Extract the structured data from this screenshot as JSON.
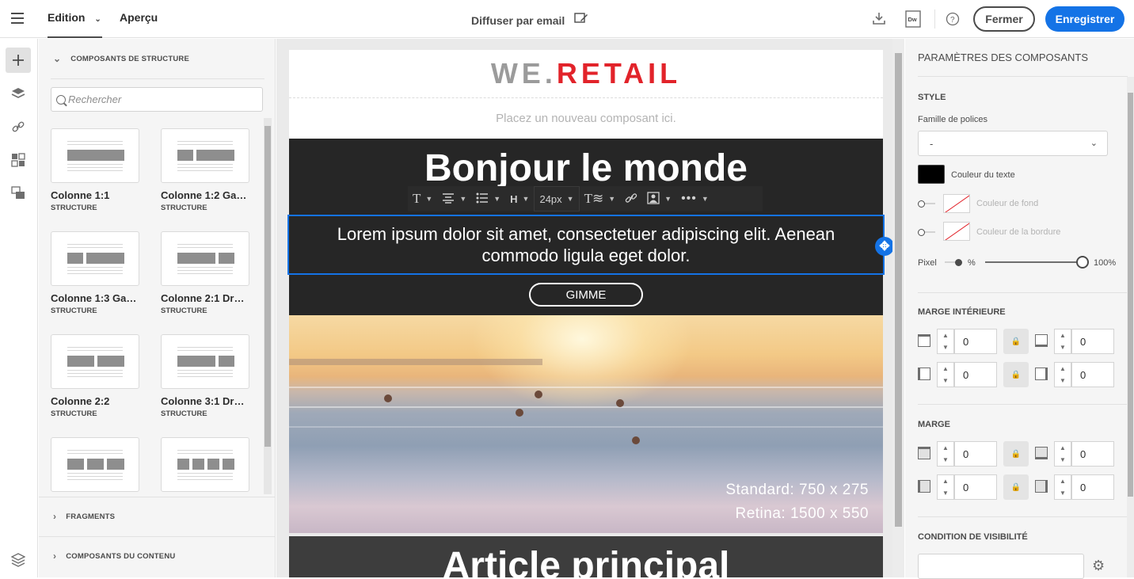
{
  "topbar": {
    "tabs": [
      "Edition",
      "Aperçu"
    ],
    "email_label": "Diffuser par email",
    "close_label": "Fermer",
    "save_label": "Enregistrer",
    "accent_color": "#1473e6"
  },
  "leftpanel": {
    "structure_title": "COMPOSANTS DE STRUCTURE",
    "search_placeholder": "Rechercher",
    "components": [
      {
        "name": "Colonne 1:1",
        "type": "STRUCTURE"
      },
      {
        "name": "Colonne 1:2 Gau...",
        "type": "STRUCTURE"
      },
      {
        "name": "Colonne 1:3 Gau...",
        "type": "STRUCTURE"
      },
      {
        "name": "Colonne 2:1 Droite",
        "type": "STRUCTURE"
      },
      {
        "name": "Colonne 2:2",
        "type": "STRUCTURE"
      },
      {
        "name": "Colonne 3:1 Droite",
        "type": "STRUCTURE"
      }
    ],
    "fragments_title": "FRAGMENTS",
    "content_title": "COMPOSANTS DU CONTENU"
  },
  "canvas": {
    "logo_we": "WE.",
    "logo_retail": "RETAIL",
    "placeholder": "Placez un nouveau composant ici.",
    "headline": "Bonjour le monde",
    "toolbar_font_size": "24px",
    "toolbar_heading": "H",
    "lorem": "Lorem ipsum dolor sit amet, consectetuer adipiscing elit. Aenean commodo ligula eget dolor.",
    "button_label": "GIMME",
    "image_spec_standard": "Standard: 750 x 275",
    "image_spec_retina": "Retina: 1500 x 550",
    "article_title": "Article principal"
  },
  "rightpanel": {
    "title": "PARAMÈTRES DES COMPOSANTS",
    "style_label": "STYLE",
    "font_family_label": "Famille de polices",
    "font_family_value": "-",
    "text_color_label": "Couleur du texte",
    "text_color": "#000000",
    "bg_color_label": "Couleur de fond",
    "border_color_label": "Couleur de la bordure",
    "pixel_label": "Pixel",
    "percent_label": "%",
    "slider_value": "100%",
    "inner_margin_label": "MARGE INTÉRIEURE",
    "margin_label": "MARGE",
    "padding_values": [
      "0",
      "0",
      "0",
      "0"
    ],
    "margin_values": [
      "0",
      "0",
      "0",
      "0"
    ],
    "visibility_label": "CONDITION DE VISIBILITÉ"
  }
}
